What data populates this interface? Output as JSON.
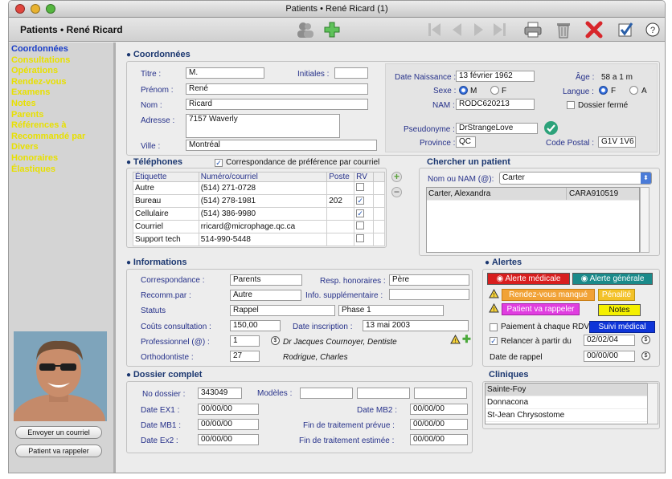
{
  "window": {
    "title": "Patients • René Ricard (1)"
  },
  "toolbar": {
    "title": "Patients • René Ricard"
  },
  "sidebar": {
    "items": [
      "Coordonnées",
      "Consultations",
      "Opérations",
      "Rendez-vous",
      "Examens",
      "Notes",
      "Parents",
      "Références à",
      "Recommandé par",
      "Divers",
      "Honoraires",
      "Élastiques"
    ],
    "send_mail": "Envoyer un courriel",
    "call_back": "Patient va rappeler"
  },
  "coord": {
    "heading": "Coordonnées",
    "titre_label": "Titre :",
    "titre": "M.",
    "initiales_label": "Initiales :",
    "initiales": "",
    "prenom_label": "Prénom :",
    "prenom": "René",
    "nom_label": "Nom :",
    "nom": "Ricard",
    "adresse_label": "Adresse :",
    "adresse": "7157 Waverly",
    "ville_label": "Ville :",
    "ville": "Montréal",
    "naissance_label": "Date Naissance :",
    "naissance": "13 février 1962",
    "age_label": "Âge :",
    "age": "58 a 1 m",
    "sexe_label": "Sexe :",
    "sexe_m": "M",
    "sexe_f": "F",
    "langue_label": "Langue :",
    "langue_f": "F",
    "langue_a": "A",
    "nam_label": "NAM :",
    "nam": "RODC620213",
    "dossier_ferme": "Dossier fermé",
    "pseudo_label": "Pseudonyme :",
    "pseudo": "DrStrangeLove",
    "province_label": "Province :",
    "province": "QC",
    "cp_label": "Code Postal :",
    "cp": "G1V 1V6"
  },
  "tel": {
    "heading": "Téléphones",
    "pref_label": "Correspondance de préférence par courriel",
    "cols": [
      "Étiquette",
      "Numéro/courriel",
      "Poste",
      "RV"
    ],
    "rows": [
      {
        "label": "Autre",
        "num": "(514) 271-0728",
        "poste": "",
        "rv": false
      },
      {
        "label": "Bureau",
        "num": "(514) 278-1981",
        "poste": "202",
        "rv": true
      },
      {
        "label": "Cellulaire",
        "num": "(514) 386-9980",
        "poste": "",
        "rv": true
      },
      {
        "label": "Courriel",
        "num": "rricard@microphage.qc.ca",
        "poste": "",
        "rv": false
      },
      {
        "label": "Support tech",
        "num": "514-990-5448",
        "poste": "",
        "rv": false
      }
    ]
  },
  "search": {
    "heading": "Chercher un patient",
    "label": "Nom ou NAM (@):",
    "value": "Carter",
    "result_name": "Carter, Alexandra",
    "result_nam": "CARA910519"
  },
  "info": {
    "heading": "Informations",
    "corr_label": "Correspondance :",
    "corr": "Parents",
    "resp_label": "Resp. honoraires :",
    "resp": "Père",
    "recomm_label": "Recomm.par :",
    "recomm": "Autre",
    "suppl_label": "Info. supplémentaire :",
    "suppl": "",
    "statuts_label": "Statuts",
    "statuts": "Rappel",
    "phase": "Phase 1",
    "couts_label": "Coûts consultation :",
    "couts": "150,00",
    "inscr_label": "Date inscription :",
    "inscr": "13 mai 2003",
    "prof_label": "Professionnel (@) :",
    "prof_id": "1",
    "prof_name": "Dr Jacques Cournoyer, Dentiste",
    "ortho_label": "Orthodontiste :",
    "ortho_id": "27",
    "ortho_name": "Rodrigue, Charles"
  },
  "alerts": {
    "heading": "Alertes",
    "medicale": "Alerte médicale",
    "generale": "Alerte générale",
    "rdv_manque": "Rendez-vous manqué",
    "penalite": "Pénalité",
    "rappeler": "Patient va rappeler",
    "notes": "Notes",
    "paiement": "Paiement à chaque RDV",
    "suivi": "Suivi médical",
    "relancer_label": "Relancer à partir du",
    "relancer": "02/02/04",
    "rappel_label": "Date de rappel",
    "rappel": "00/00/00"
  },
  "dossier": {
    "heading": "Dossier complet",
    "no_label": "No dossier :",
    "no": "343049",
    "modeles_label": "Modèles :",
    "ex1_label": "Date EX1 :",
    "ex1": "00/00/00",
    "mb2_label": "Date MB2 :",
    "mb2": "00/00/00",
    "mb1_label": "Date MB1 :",
    "mb1": "00/00/00",
    "fin_prevue_label": "Fin de traitement prévue :",
    "fin_prevue": "00/00/00",
    "ex2_label": "Date Ex2 :",
    "ex2": "00/00/00",
    "fin_est_label": "Fin de traitement estimée :",
    "fin_est": "00/00/00"
  },
  "cliniques": {
    "heading": "Cliniques",
    "items": [
      "Sainte-Foy",
      "Donnacona",
      "St-Jean Chrysostome"
    ]
  }
}
